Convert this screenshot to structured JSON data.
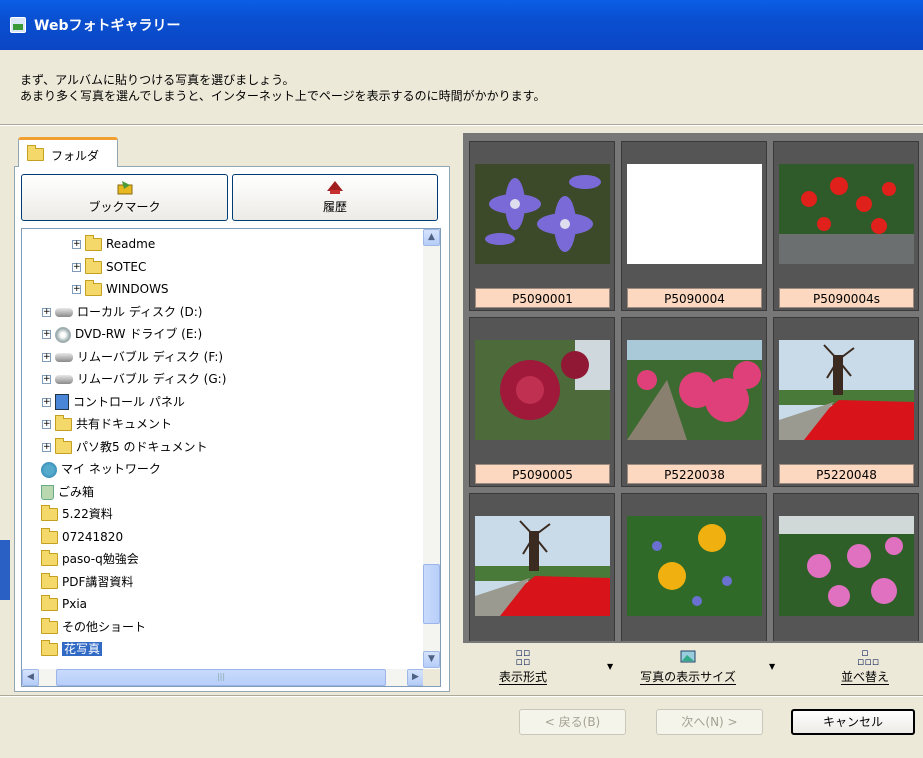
{
  "window": {
    "title": "Webフォトギャラリー"
  },
  "instructions": [
    "まず、アルバムに貼りつける写真を選びましょう。",
    "あまり多く写真を選んでしまうと、インターネット上でページを表示するのに時間がかかります。"
  ],
  "left": {
    "tab_label": "フォルダ",
    "bookmark_label": "ブックマーク",
    "history_label": "履歴"
  },
  "tree": [
    {
      "label": "Readme",
      "icon": "folder-icon",
      "expander": "+"
    },
    {
      "label": "SOTEC",
      "icon": "folder-icon",
      "expander": "+"
    },
    {
      "label": "WINDOWS",
      "icon": "folder-icon",
      "expander": "+"
    },
    {
      "label": "ローカル ディスク (D:)",
      "icon": "drive-icon",
      "expander": "+"
    },
    {
      "label": "DVD-RW ドライブ (E:)",
      "icon": "dvd-icon",
      "expander": "+"
    },
    {
      "label": "リムーバブル ディスク (F:)",
      "icon": "drive-icon",
      "expander": "+"
    },
    {
      "label": "リムーバブル ディスク (G:)",
      "icon": "drive-icon",
      "expander": "+"
    },
    {
      "label": "コントロール パネル",
      "icon": "control-panel-icon",
      "expander": "+"
    },
    {
      "label": "共有ドキュメント",
      "icon": "folder-icon",
      "expander": "+"
    },
    {
      "label": "パソ教5 のドキュメント",
      "icon": "folder-icon",
      "expander": "+"
    },
    {
      "label": "マイ ネットワーク",
      "icon": "network-icon",
      "expander": ""
    },
    {
      "label": "ごみ箱",
      "icon": "recycle-bin-icon",
      "expander": ""
    },
    {
      "label": "5.22資料",
      "icon": "folder-icon",
      "expander": ""
    },
    {
      "label": "07241820",
      "icon": "folder-icon",
      "expander": ""
    },
    {
      "label": "paso-q勉強会",
      "icon": "folder-icon",
      "expander": ""
    },
    {
      "label": "PDF講習資料",
      "icon": "folder-icon",
      "expander": ""
    },
    {
      "label": "Pxia",
      "icon": "folder-icon",
      "expander": ""
    },
    {
      "label": "その他ショート",
      "icon": "folder-icon",
      "expander": ""
    },
    {
      "label": "花写真",
      "icon": "folder-icon",
      "expander": "",
      "selected": true
    }
  ],
  "photos": [
    {
      "name": "P5090001",
      "subject": "purple clematis"
    },
    {
      "name": "P5090004",
      "subject": "blank"
    },
    {
      "name": "P5090004s",
      "subject": "red flowers"
    },
    {
      "name": "P5090005",
      "subject": "red rose"
    },
    {
      "name": "P5220038",
      "subject": "pink flower bed"
    },
    {
      "name": "P5220048",
      "subject": "windmill and red field"
    },
    {
      "name": "",
      "subject": "windmill and red field"
    },
    {
      "name": "",
      "subject": "yellow flowers"
    },
    {
      "name": "",
      "subject": "pink flowers"
    }
  ],
  "toolbar": {
    "view_label": "表示形式",
    "size_label": "写真の表示サイズ",
    "sort_label": "並べ替え"
  },
  "nav": {
    "back_label": "< 戻る(B)",
    "next_label": "次へ(N) >",
    "cancel_label": "キャンセル"
  },
  "colors": {
    "title_bar": "#0a4fd0",
    "selection": "#316ac5",
    "caption_bg": "#fcd8c0"
  }
}
